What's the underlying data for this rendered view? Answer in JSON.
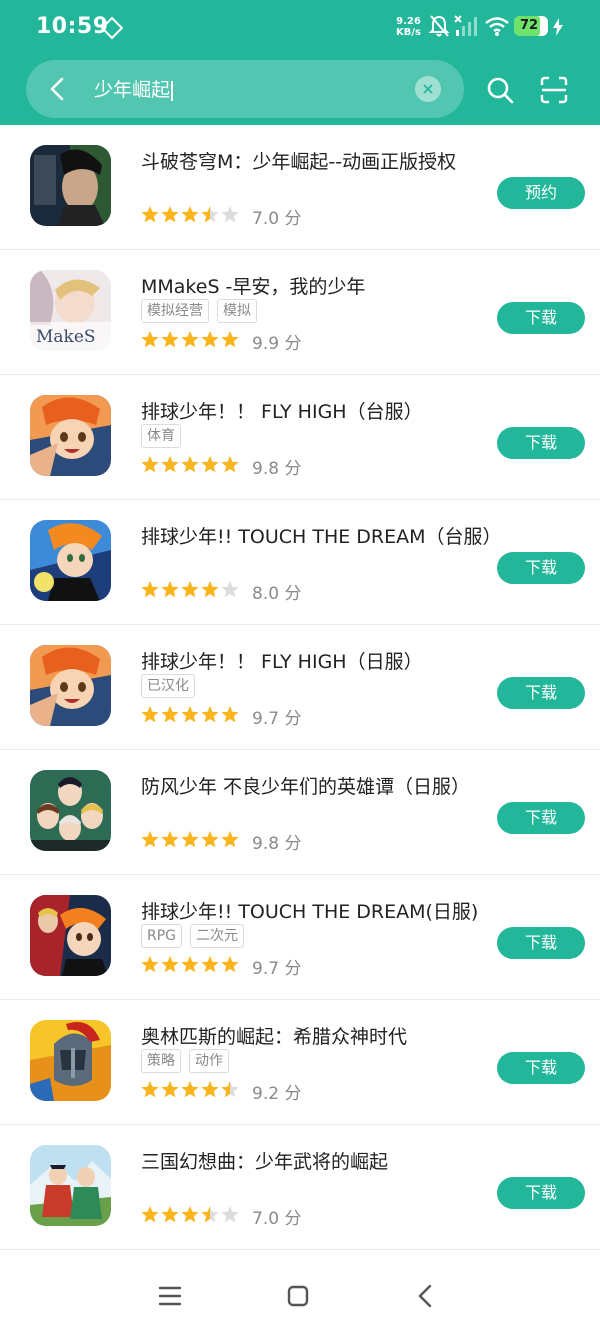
{
  "status_bar": {
    "time": "10:59",
    "net_speed_value": "9.26",
    "net_speed_unit": "KB/s",
    "battery": "72"
  },
  "search": {
    "query": "少年崛起"
  },
  "colors": {
    "accent": "#22b79a",
    "star": "#f9b51b",
    "star_empty": "#dcdcdc"
  },
  "apps": [
    {
      "name": "斗破苍穹M：少年崛起--动画正版授权",
      "tags": [],
      "rating": 3.5,
      "score": "7.0 分",
      "action": "预约"
    },
    {
      "name": "MMakeS -早安，我的少年",
      "tags": [
        "模拟经营",
        "模拟"
      ],
      "rating": 5,
      "score": "9.9 分",
      "action": "下载"
    },
    {
      "name": "排球少年！！ FLY HIGH（台服）",
      "tags": [
        "体育"
      ],
      "rating": 5,
      "score": "9.8 分",
      "action": "下载"
    },
    {
      "name": "排球少年!! TOUCH THE DREAM（台服）",
      "tags": [],
      "rating": 4,
      "score": "8.0 分",
      "action": "下载"
    },
    {
      "name": "排球少年！！ FLY HIGH（日服）",
      "tags": [
        "已汉化"
      ],
      "rating": 5,
      "score": "9.7 分",
      "action": "下载"
    },
    {
      "name": "防风少年 不良少年们的英雄谭（日服）",
      "tags": [],
      "rating": 5,
      "score": "9.8 分",
      "action": "下载"
    },
    {
      "name": "排球少年!! TOUCH THE DREAM(日服)",
      "tags": [
        "RPG",
        "二次元"
      ],
      "rating": 5,
      "score": "9.7 分",
      "action": "下载"
    },
    {
      "name": "奥林匹斯的崛起：希腊众神时代",
      "tags": [
        "策略",
        "动作"
      ],
      "rating": 4.5,
      "score": "9.2 分",
      "action": "下载"
    },
    {
      "name": "三国幻想曲：少年武将的崛起",
      "tags": [],
      "rating": 3.5,
      "score": "7.0 分",
      "action": "下载"
    }
  ]
}
